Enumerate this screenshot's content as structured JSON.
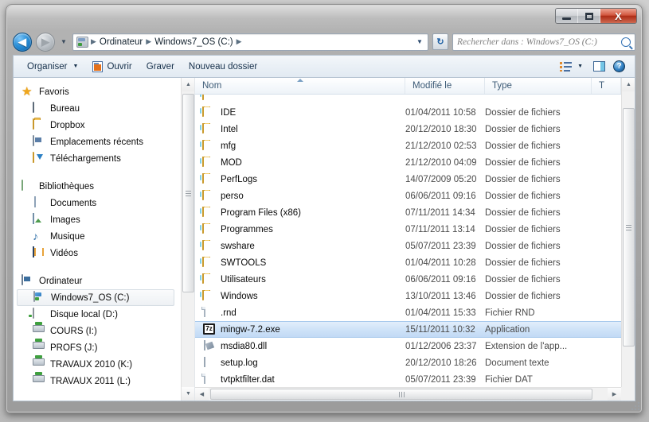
{
  "window": {
    "controls": {
      "minimize": "–",
      "maximize": "□",
      "close": "X"
    }
  },
  "nav": {
    "back_label": "◀",
    "forward_label": "▶",
    "recent_dropdown": "▼",
    "address_dropdown": "▼",
    "refresh_label": "↻",
    "breadcrumbs": [
      {
        "label": "Ordinateur"
      },
      {
        "label": "Windows7_OS (C:)"
      }
    ],
    "separator": "▶"
  },
  "search": {
    "placeholder": "Rechercher dans : Windows7_OS (C:)"
  },
  "toolbar": {
    "organize_label": "Organiser",
    "organize_caret": "▼",
    "open_label": "Ouvrir",
    "burn_label": "Graver",
    "new_folder_label": "Nouveau dossier",
    "view_caret": "▼",
    "help_label": "?"
  },
  "sidebar": {
    "groups": [
      {
        "header": {
          "label": "Favoris",
          "icon": "star-icon"
        },
        "items": [
          {
            "label": "Bureau",
            "icon": "desktop-icon"
          },
          {
            "label": "Dropbox",
            "icon": "folder-icon"
          },
          {
            "label": "Emplacements récents",
            "icon": "recent-places-icon"
          },
          {
            "label": "Téléchargements",
            "icon": "downloads-icon"
          }
        ]
      },
      {
        "header": {
          "label": "Bibliothèques",
          "icon": "library-icon"
        },
        "items": [
          {
            "label": "Documents",
            "icon": "document-icon"
          },
          {
            "label": "Images",
            "icon": "picture-icon"
          },
          {
            "label": "Musique",
            "icon": "music-icon"
          },
          {
            "label": "Vidéos",
            "icon": "video-icon"
          }
        ]
      },
      {
        "header": {
          "label": "Ordinateur",
          "icon": "computer-icon"
        },
        "items": [
          {
            "label": "Windows7_OS (C:)",
            "icon": "windows-drive-icon",
            "selected": true
          },
          {
            "label": "Disque local (D:)",
            "icon": "disk-icon"
          },
          {
            "label": "COURS (I:)",
            "icon": "network-drive-icon"
          },
          {
            "label": "PROFS (J:)",
            "icon": "network-drive-icon"
          },
          {
            "label": "TRAVAUX 2010 (K:)",
            "icon": "network-drive-icon"
          },
          {
            "label": "TRAVAUX 2011 (L:)",
            "icon": "network-drive-icon"
          }
        ]
      }
    ]
  },
  "filelist": {
    "columns": [
      {
        "key": "name",
        "label": "Nom",
        "sorted": true
      },
      {
        "key": "modified",
        "label": "Modifié le"
      },
      {
        "key": "type",
        "label": "Type"
      },
      {
        "key": "size",
        "label": "T"
      }
    ],
    "rows": [
      {
        "name": "",
        "modified": "",
        "type": "",
        "size": "",
        "icon": "folder-icon",
        "partial": true
      },
      {
        "name": "IDE",
        "modified": "01/04/2011 10:58",
        "type": "Dossier de fichiers",
        "size": "",
        "icon": "folder-icon"
      },
      {
        "name": "Intel",
        "modified": "20/12/2010 18:30",
        "type": "Dossier de fichiers",
        "size": "",
        "icon": "folder-icon"
      },
      {
        "name": "mfg",
        "modified": "21/12/2010 02:53",
        "type": "Dossier de fichiers",
        "size": "",
        "icon": "folder-icon"
      },
      {
        "name": "MOD",
        "modified": "21/12/2010 04:09",
        "type": "Dossier de fichiers",
        "size": "",
        "icon": "folder-icon"
      },
      {
        "name": "PerfLogs",
        "modified": "14/07/2009 05:20",
        "type": "Dossier de fichiers",
        "size": "",
        "icon": "folder-icon"
      },
      {
        "name": "perso",
        "modified": "06/06/2011 09:16",
        "type": "Dossier de fichiers",
        "size": "",
        "icon": "folder-icon"
      },
      {
        "name": "Program Files (x86)",
        "modified": "07/11/2011 14:34",
        "type": "Dossier de fichiers",
        "size": "",
        "icon": "folder-icon"
      },
      {
        "name": "Programmes",
        "modified": "07/11/2011 13:14",
        "type": "Dossier de fichiers",
        "size": "",
        "icon": "folder-icon"
      },
      {
        "name": "swshare",
        "modified": "05/07/2011 23:39",
        "type": "Dossier de fichiers",
        "size": "",
        "icon": "folder-icon"
      },
      {
        "name": "SWTOOLS",
        "modified": "01/04/2011 10:28",
        "type": "Dossier de fichiers",
        "size": "",
        "icon": "folder-icon"
      },
      {
        "name": "Utilisateurs",
        "modified": "06/06/2011 09:16",
        "type": "Dossier de fichiers",
        "size": "",
        "icon": "folder-icon"
      },
      {
        "name": "Windows",
        "modified": "13/10/2011 13:46",
        "type": "Dossier de fichiers",
        "size": "",
        "icon": "folder-icon"
      },
      {
        "name": ".rnd",
        "modified": "01/04/2011 15:33",
        "type": "Fichier RND",
        "size": "",
        "icon": "file-icon"
      },
      {
        "name": "mingw-7.2.exe",
        "modified": "15/11/2011 10:32",
        "type": "Application",
        "size": "",
        "icon": "7zip-icon",
        "selected": true
      },
      {
        "name": "msdia80.dll",
        "modified": "01/12/2006 23:37",
        "type": "Extension de l'app...",
        "size": "",
        "icon": "dll-icon"
      },
      {
        "name": "setup.log",
        "modified": "20/12/2010 18:26",
        "type": "Document texte",
        "size": "",
        "icon": "log-icon"
      },
      {
        "name": "tvtpktfilter.dat",
        "modified": "05/07/2011 23:39",
        "type": "Fichier DAT",
        "size": "",
        "icon": "file-icon"
      }
    ]
  },
  "scrollbars": {
    "up_arrow": "▲",
    "down_arrow": "▼",
    "left_arrow": "◀",
    "right_arrow": "▶"
  },
  "colors": {
    "selection": "#cfe3f8",
    "selection_border": "#a7c9ec",
    "header_text": "#3c5a76",
    "accent": "#2a8fd8"
  }
}
